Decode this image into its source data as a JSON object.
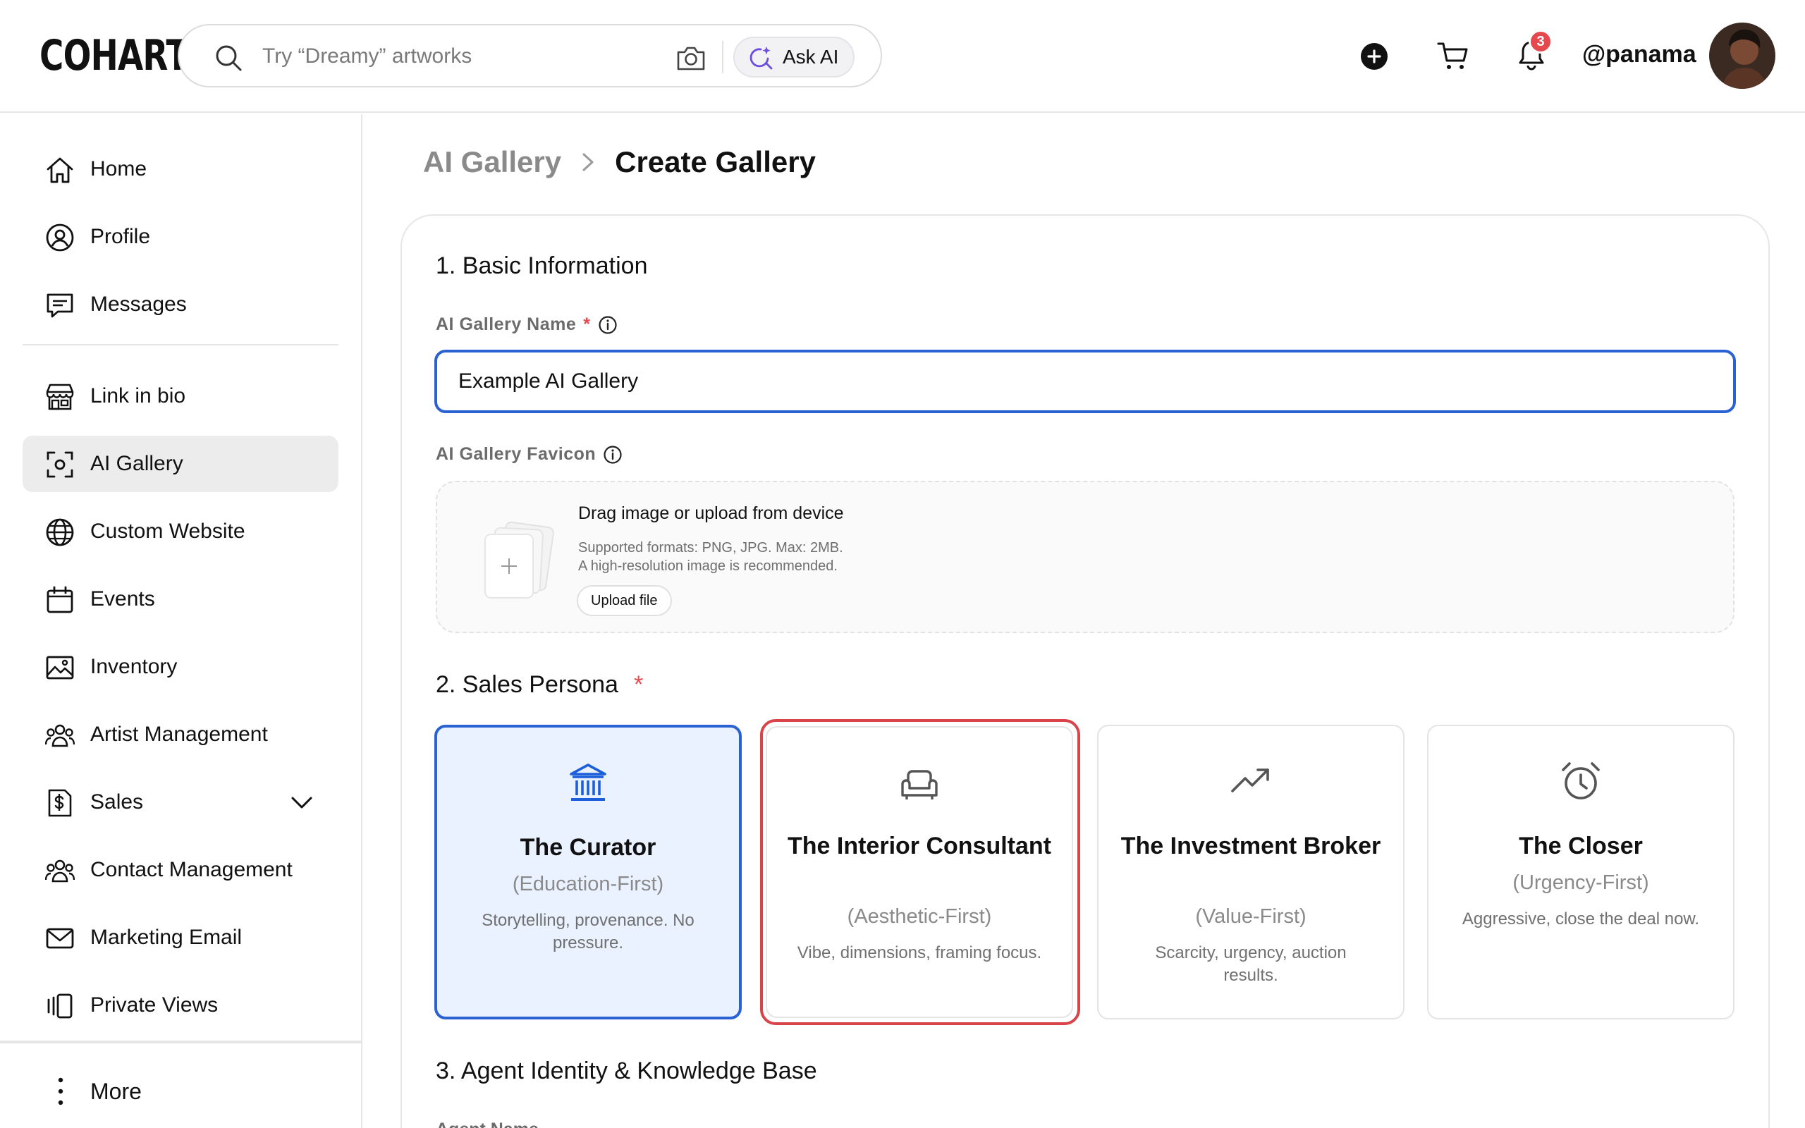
{
  "header": {
    "logo": "COHART",
    "search": {
      "placeholder": "Try “Dreamy” artworks",
      "value": ""
    },
    "ask_ai_label": "Ask AI",
    "notifications_count": "3",
    "username": "@panama"
  },
  "sidebar": {
    "items": [
      {
        "label": "Home",
        "icon": "home-icon"
      },
      {
        "label": "Profile",
        "icon": "user-circle-icon"
      },
      {
        "label": "Messages",
        "icon": "chat-icon"
      },
      {
        "label": "Link in bio",
        "icon": "storefront-icon"
      },
      {
        "label": "AI Gallery",
        "icon": "scan-icon",
        "active": true
      },
      {
        "label": "Custom Website",
        "icon": "globe-icon"
      },
      {
        "label": "Events",
        "icon": "calendar-icon"
      },
      {
        "label": "Inventory",
        "icon": "image-icon"
      },
      {
        "label": "Artist Management",
        "icon": "users-icon"
      },
      {
        "label": "Sales",
        "icon": "dollar-doc-icon",
        "expandable": true
      },
      {
        "label": "Contact Management",
        "icon": "users-icon"
      },
      {
        "label": "Marketing Email",
        "icon": "mail-icon"
      },
      {
        "label": "Private Views",
        "icon": "views-icon"
      }
    ],
    "more_label": "More"
  },
  "breadcrumb": {
    "parent": "AI Gallery",
    "current": "Create Gallery"
  },
  "form": {
    "section1_title": "1. Basic Information",
    "name_label": "AI Gallery Name",
    "name_required_mark": "*",
    "name_value": "Example AI Gallery",
    "favicon_label": "AI Gallery Favicon",
    "upload": {
      "title": "Drag image or upload from device",
      "formats": "Supported formats: PNG, JPG. Max: 2MB.",
      "hint": "A high-resolution image is recommended.",
      "button": "Upload file"
    },
    "section2_title": "2. Sales Persona",
    "section2_required_mark": "*",
    "personas": [
      {
        "name": "The Curator",
        "tag": "(Education-First)",
        "desc": "Storytelling, provenance. No pressure.",
        "icon": "museum-icon",
        "selected": true
      },
      {
        "name": "The Interior Consultant",
        "tag": "(Aesthetic-First)",
        "desc": "Vibe, dimensions, framing focus.",
        "icon": "armchair-icon"
      },
      {
        "name": "The Investment Broker",
        "tag": "(Value-First)",
        "desc": "Scarcity, urgency, auction results.",
        "icon": "trend-up-icon"
      },
      {
        "name": "The Closer",
        "tag": "(Urgency-First)",
        "desc": "Aggressive, close the deal now.",
        "icon": "alarm-clock-icon"
      }
    ],
    "section3_title": "3. Agent Identity & Knowledge Base",
    "agent_name_label": "Agent Name"
  },
  "colors": {
    "accent": "#2a62d4",
    "selected_bg": "#eaf2ff",
    "required": "#e5484d",
    "focus_ring": "#d9434a"
  }
}
